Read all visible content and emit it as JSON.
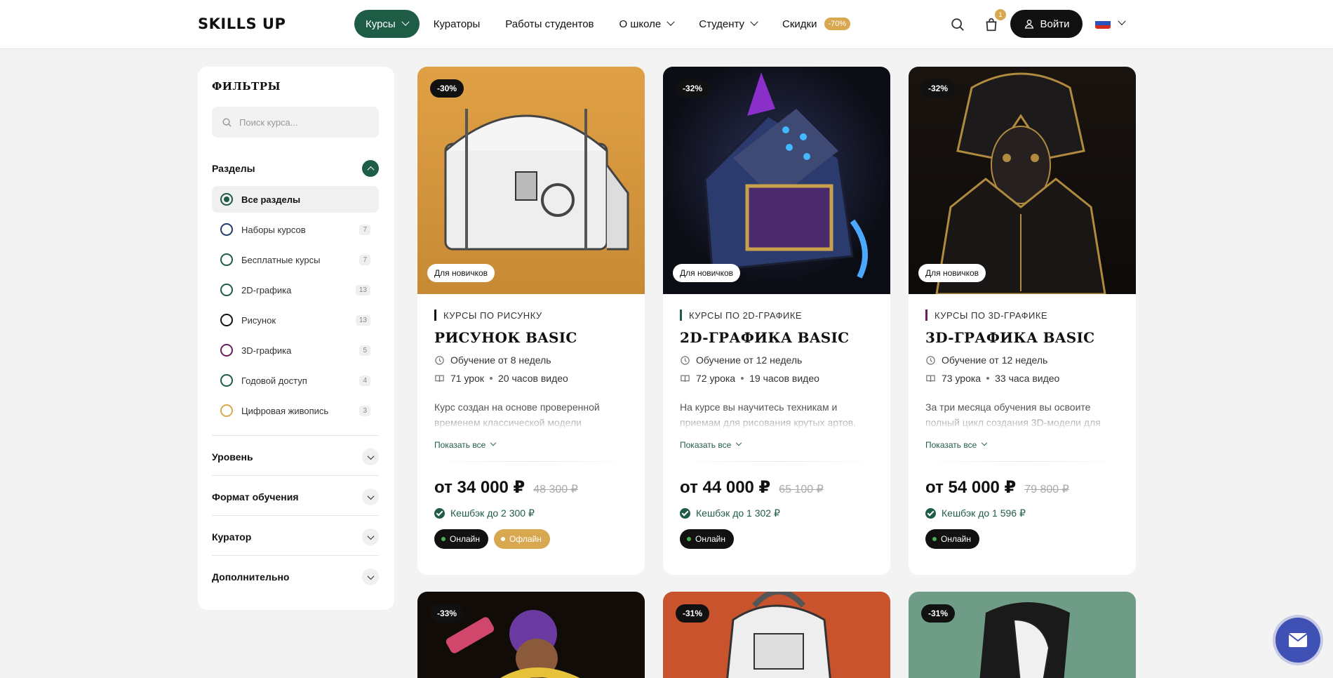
{
  "header": {
    "logo": "SKILLS UP",
    "nav": [
      {
        "label": "Курсы"
      },
      {
        "label": "Кураторы"
      },
      {
        "label": "Работы студентов"
      },
      {
        "label": "О школе"
      },
      {
        "label": "Студенту"
      },
      {
        "label": "Скидки"
      }
    ],
    "sale_badge": "-70%",
    "cart_count": "1",
    "login_label": "Войти"
  },
  "sidebar": {
    "title": "ФИЛЬТРЫ",
    "search_placeholder": "Поиск курса...",
    "sections_title": "Разделы",
    "categories": [
      {
        "label": "Все разделы",
        "count": "",
        "color": "#1f5c45"
      },
      {
        "label": "Наборы курсов",
        "count": "7",
        "color": "#1f3c6c"
      },
      {
        "label": "Бесплатные курсы",
        "count": "7",
        "color": "#1f5c45"
      },
      {
        "label": "2D-графика",
        "count": "13",
        "color": "#1f5c45"
      },
      {
        "label": "Рисунок",
        "count": "13",
        "color": "#111111"
      },
      {
        "label": "3D-графика",
        "count": "5",
        "color": "#6a1f5c"
      },
      {
        "label": "Годовой доступ",
        "count": "4",
        "color": "#1f5c45"
      },
      {
        "label": "Цифровая живопись",
        "count": "3",
        "color": "#d7a84f"
      }
    ],
    "filters": [
      {
        "label": "Уровень"
      },
      {
        "label": "Формат обучения"
      },
      {
        "label": "Куратор"
      },
      {
        "label": "Дополнительно"
      }
    ]
  },
  "cards": [
    {
      "discount": "-30%",
      "badge": "Для новичков",
      "category": "КУРСЫ ПО РИСУНКУ",
      "category_color": "#111111",
      "title": "РИСУНОК BASIC",
      "duration": "Обучение от 8 недель",
      "lessons": "71 урок",
      "video": "20 часов видео",
      "description": "Курс создан на основе проверенной временем классической модели",
      "show_all": "Показать все",
      "price": "от 34 000 ₽",
      "old_price": "48 300 ₽",
      "cashback": "Кешбэк до 2 300 ₽",
      "formats": [
        "Онлайн",
        "Офлайн"
      ],
      "image_bg": "#d99a3e"
    },
    {
      "discount": "-32%",
      "badge": "Для новичков",
      "category": "КУРСЫ ПО 2D-ГРАФИКЕ",
      "category_color": "#1f5c45",
      "title": "2D-ГРАФИКА BASIC",
      "duration": "Обучение от 12 недель",
      "lessons": "72 урока",
      "video": "19 часов видео",
      "description": "На курсе вы научитесь техникам и приемам для рисования крутых артов,",
      "show_all": "Показать все",
      "price": "от 44 000 ₽",
      "old_price": "65 100 ₽",
      "cashback": "Кешбэк до 1 302 ₽",
      "formats": [
        "Онлайн"
      ],
      "image_bg": "#0b0d14"
    },
    {
      "discount": "-32%",
      "badge": "Для новичков",
      "category": "КУРСЫ ПО 3D-ГРАФИКЕ",
      "category_color": "#6a1f5c",
      "title": "3D-ГРАФИКА BASIC",
      "duration": "Обучение от 12 недель",
      "lessons": "73 урока",
      "video": "33 часа видео",
      "description": "За три месяца обучения вы освоите полный цикл создания 3D-модели для",
      "show_all": "Показать все",
      "price": "от 54 000 ₽",
      "old_price": "79 800 ₽",
      "cashback": "Кешбэк до 1 596 ₽",
      "formats": [
        "Онлайн"
      ],
      "image_bg": "#120d0b"
    }
  ],
  "bottom_cards": [
    {
      "discount": "-33%",
      "image_bg": "#120c08"
    },
    {
      "discount": "-31%",
      "image_bg": "#c8532d"
    },
    {
      "discount": "-31%",
      "image_bg": "#6f9c86"
    }
  ]
}
